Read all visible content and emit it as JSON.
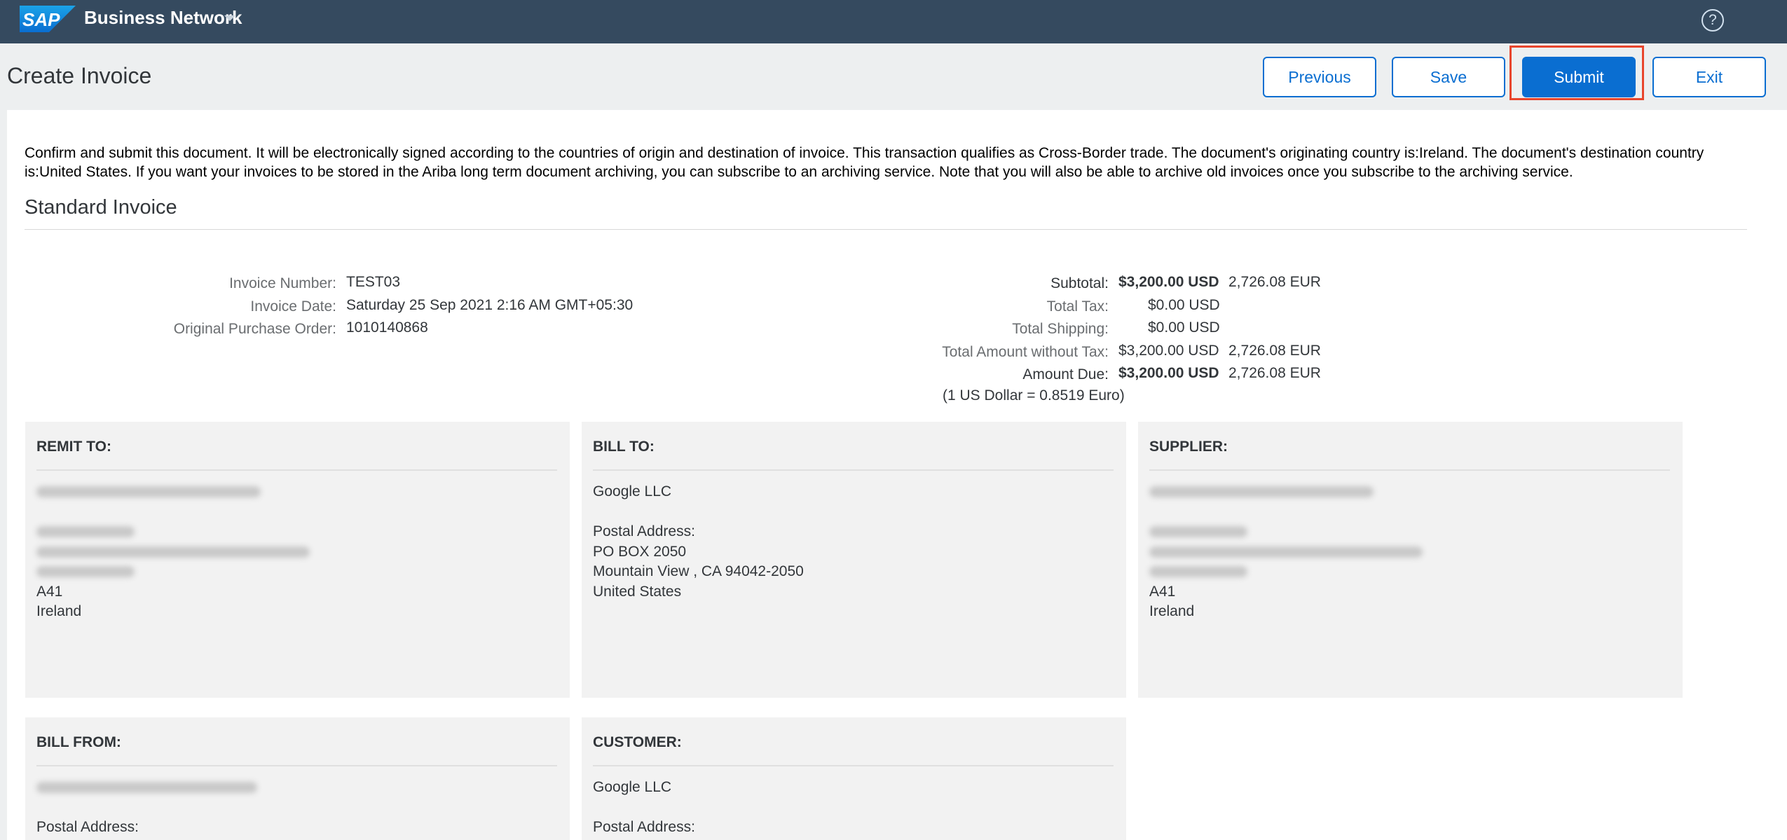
{
  "shell": {
    "logo_text": "SAP",
    "product_name": "Business Network",
    "help_label": "?"
  },
  "header": {
    "title": "Create Invoice",
    "buttons": {
      "previous": "Previous",
      "save": "Save",
      "submit": "Submit",
      "exit": "Exit"
    }
  },
  "notice_text": "Confirm and submit this document. It will be electronically signed according to the countries of origin and destination of invoice. This transaction qualifies as Cross-Border trade. The document's originating country is:Ireland. The document's destination country is:United States. If you want your invoices to be stored in the Ariba long term document archiving, you can subscribe to an archiving service. Note that you will also be able to archive old invoices once you subscribe to the archiving service.",
  "section_title": "Standard Invoice",
  "invoice_info": {
    "number_label": "Invoice Number:",
    "number_value": "TEST03",
    "date_label": "Invoice Date:",
    "date_value": "Saturday 25 Sep 2021 2:16 AM GMT+05:30",
    "po_label": "Original Purchase Order:",
    "po_value": "1010140868"
  },
  "totals": {
    "subtotal_label": "Subtotal:",
    "subtotal_usd": "$3,200.00 USD",
    "subtotal_eur": "2,726.08 EUR",
    "tax_label": "Total Tax:",
    "tax_usd": "$0.00 USD",
    "shipping_label": "Total Shipping:",
    "shipping_usd": "$0.00 USD",
    "without_tax_label": "Total Amount without Tax:",
    "without_tax_usd": "$3,200.00 USD",
    "without_tax_eur": "2,726.08 EUR",
    "due_label": "Amount Due:",
    "due_usd": "$3,200.00 USD",
    "due_eur": "2,726.08 EUR",
    "exchange_rate": "(1 US Dollar = 0.8519 Euro)"
  },
  "cards": {
    "remit_to": {
      "title": "REMIT TO:",
      "line_region": "A41",
      "line_country": "Ireland"
    },
    "bill_to": {
      "title": "BILL TO:",
      "name": "Google LLC",
      "postal_label": "Postal Address:",
      "line1": "PO BOX 2050",
      "line2": "Mountain View , CA 94042-2050",
      "line3": "United States"
    },
    "supplier": {
      "title": "SUPPLIER:",
      "line_region": "A41",
      "line_country": "Ireland"
    },
    "bill_from": {
      "title": "BILL FROM:",
      "postal_label": "Postal Address:"
    },
    "customer": {
      "title": "CUSTOMER:",
      "name": "Google LLC",
      "postal_label": "Postal Address:"
    }
  }
}
